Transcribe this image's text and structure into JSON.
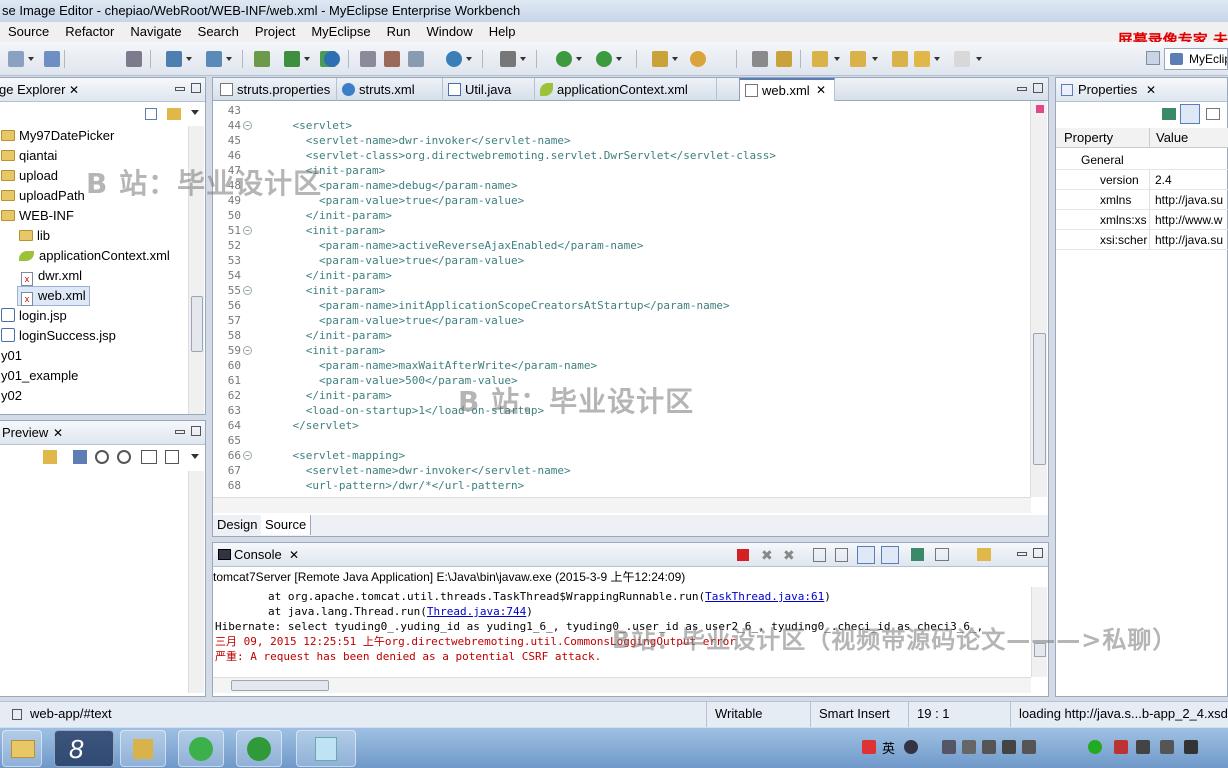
{
  "window": {
    "title": "se Image Editor - chepiao/WebRoot/WEB-INF/web.xml - MyEclipse Enterprise Workbench"
  },
  "watermark_top": "屏幕录像专家  未",
  "menu": [
    "Source",
    "Refactor",
    "Navigate",
    "Search",
    "Project",
    "MyEclipse",
    "Run",
    "Window",
    "Help"
  ],
  "perspective": "MyEclip",
  "explorer": {
    "title": "ge Explorer",
    "items": [
      {
        "label": "My97DatePicker",
        "icon": "folder-icon"
      },
      {
        "label": "qiantai",
        "icon": "folder-icon"
      },
      {
        "label": "upload",
        "icon": "folder-icon"
      },
      {
        "label": "uploadPath",
        "icon": "folder-icon"
      },
      {
        "label": "WEB-INF",
        "icon": "folder-icon"
      },
      {
        "label": "lib",
        "icon": "folder-icon"
      },
      {
        "label": "applicationContext.xml",
        "icon": "spring-leaf-icon"
      },
      {
        "label": "dwr.xml",
        "icon": "xml-file-icon"
      },
      {
        "label": "web.xml",
        "icon": "xml-file-icon"
      },
      {
        "label": "login.jsp",
        "icon": "jsp-file-icon"
      },
      {
        "label": "loginSuccess.jsp",
        "icon": "jsp-file-icon"
      },
      {
        "label": "y01",
        "icon": "project-icon"
      },
      {
        "label": "y01_example",
        "icon": "project-icon"
      },
      {
        "label": "y02",
        "icon": "project-icon"
      }
    ]
  },
  "preview": {
    "title": "Preview"
  },
  "editor": {
    "tabs": [
      {
        "label": "struts.properties"
      },
      {
        "label": "struts.xml"
      },
      {
        "label": "Util.java"
      },
      {
        "label": "applicationContext.xml"
      },
      {
        "label": "web.xml"
      }
    ],
    "lines": [
      {
        "n": "43",
        "code": ""
      },
      {
        "n": "44",
        "code": "    <servlet>"
      },
      {
        "n": "45",
        "code": "      <servlet-name>dwr-invoker</servlet-name>"
      },
      {
        "n": "46",
        "code": "      <servlet-class>org.directwebremoting.servlet.DwrServlet</servlet-class>"
      },
      {
        "n": "47",
        "code": "      <init-param>"
      },
      {
        "n": "48",
        "code": "        <param-name>debug</param-name>"
      },
      {
        "n": "49",
        "code": "        <param-value>true</param-value>"
      },
      {
        "n": "50",
        "code": "      </init-param>"
      },
      {
        "n": "51",
        "code": "      <init-param>"
      },
      {
        "n": "52",
        "code": "        <param-name>activeReverseAjaxEnabled</param-name>"
      },
      {
        "n": "53",
        "code": "        <param-value>true</param-value>"
      },
      {
        "n": "54",
        "code": "      </init-param>"
      },
      {
        "n": "55",
        "code": "      <init-param>"
      },
      {
        "n": "56",
        "code": "        <param-name>initApplicationScopeCreatorsAtStartup</param-name>"
      },
      {
        "n": "57",
        "code": "        <param-value>true</param-value>"
      },
      {
        "n": "58",
        "code": "      </init-param>"
      },
      {
        "n": "59",
        "code": "      <init-param>"
      },
      {
        "n": "60",
        "code": "        <param-name>maxWaitAfterWrite</param-name>"
      },
      {
        "n": "61",
        "code": "        <param-value>500</param-value>"
      },
      {
        "n": "62",
        "code": "      </init-param>"
      },
      {
        "n": "63",
        "code": "      <load-on-startup>1</load-on-startup>"
      },
      {
        "n": "64",
        "code": "    </servlet>"
      },
      {
        "n": "65",
        "code": ""
      },
      {
        "n": "66",
        "code": "    <servlet-mapping>"
      },
      {
        "n": "67",
        "code": "      <servlet-name>dwr-invoker</servlet-name>"
      },
      {
        "n": "68",
        "code": "      <url-pattern>/dwr/*</url-pattern>"
      }
    ],
    "bottom_tabs": [
      "Design",
      "Source"
    ]
  },
  "console": {
    "title": "Console",
    "header": "tomcat7Server [Remote Java Application] E:\\Java\\bin\\javaw.exe (2015-3-9 上午12:24:09)",
    "lines": [
      {
        "pre": "        at org.apache.tomcat.util.threads.TaskThread$WrappingRunnable.run(",
        "link": "TaskThread.java:61",
        "post": ")"
      },
      {
        "pre": "        at java.lang.Thread.run(",
        "link": "Thread.java:744",
        "post": ")"
      },
      {
        "pre": "Hibernate: select tyuding0_.yuding_id as yuding1_6_, tyuding0_.user_id as user2_6_, tyuding0_.checi_id as checi3_6_,",
        "link": "",
        "post": ""
      },
      {
        "pre": "三月 09, 2015 12:25:51 上午org.directwebremoting.util.CommonsLoggingOutput error",
        "link": "",
        "post": ""
      },
      {
        "pre": "严重: A request has been denied as a potential CSRF attack.",
        "link": "",
        "post": ""
      }
    ]
  },
  "properties": {
    "title": "Properties",
    "col_property": "Property",
    "col_value": "Value",
    "group": "General",
    "rows": [
      {
        "key": "version",
        "value": "2.4"
      },
      {
        "key": "xmlns",
        "value": "http://java.su"
      },
      {
        "key": "xmlns:xs",
        "value": "http://www.w"
      },
      {
        "key": "xsi:scher",
        "value": "http://java.su"
      }
    ]
  },
  "status": {
    "path": "web-app/#text",
    "writable": "Writable",
    "insert_mode": "Smart Insert",
    "position": "19 : 1",
    "loading": "loading http://java.s...b-app_2_4.xsd"
  },
  "watermarks": {
    "a": "B 站：毕业设计区",
    "b": "B 站：毕业设计区",
    "c": "B站：毕业设计区（视频带源码论文———>私聊）"
  },
  "taskbar": {
    "ime": "英"
  },
  "colors": {
    "tag": "#3f7f7f",
    "link": "#0000cc",
    "accent": "#5b7fb5"
  }
}
